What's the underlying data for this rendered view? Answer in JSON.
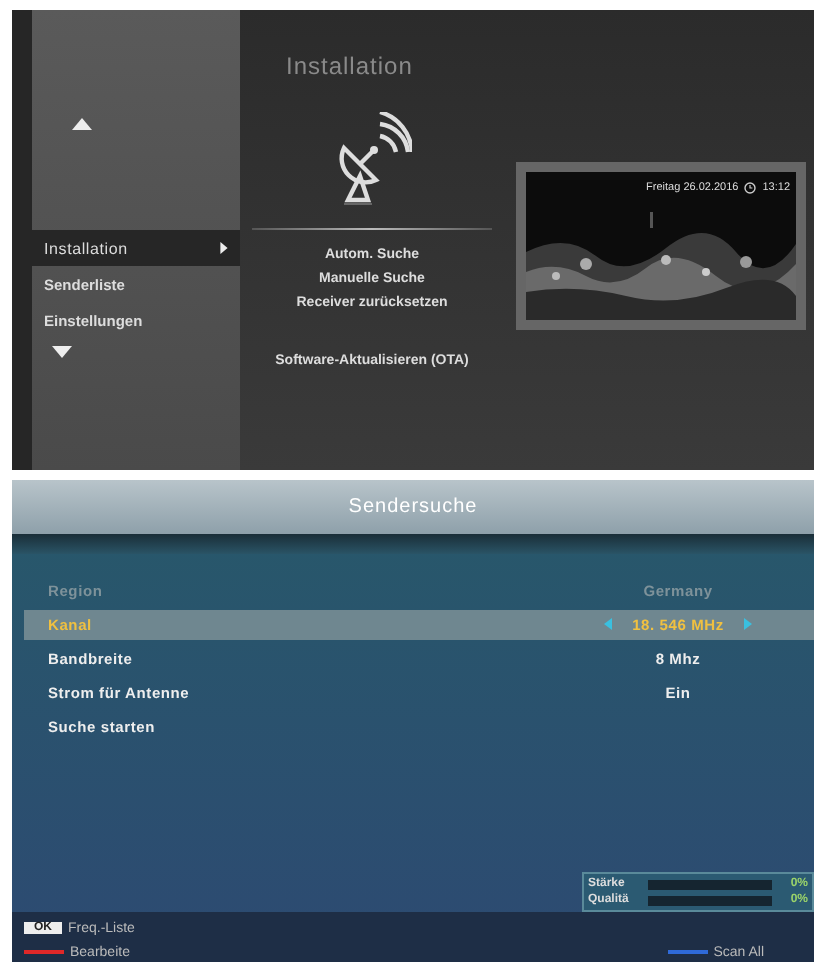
{
  "menu": {
    "title": "Installation",
    "sidebar_items": [
      {
        "label": "Installation",
        "selected": true
      },
      {
        "label": "Senderliste",
        "selected": false
      },
      {
        "label": "Einstellungen",
        "selected": false
      }
    ],
    "submenu": [
      {
        "label": "Autom. Suche",
        "kind": "item"
      },
      {
        "label": "Manuelle Suche",
        "kind": "item"
      },
      {
        "label": "Receiver zurücksetzen",
        "kind": "item"
      },
      {
        "label": "Software-Aktualisieren (OTA)",
        "kind": "spaced"
      }
    ],
    "preview": {
      "date": "Freitag 26.02.2016",
      "time": "13:12"
    }
  },
  "scan": {
    "title": "Sendersuche",
    "rows": [
      {
        "label": "Region",
        "value": "Germany",
        "disabled": true,
        "selected": false
      },
      {
        "label": "Kanal",
        "value": "18. 546 MHz",
        "disabled": false,
        "selected": true
      },
      {
        "label": "Bandbreite",
        "value": "8 Mhz",
        "disabled": false,
        "selected": false
      },
      {
        "label": "Strom für Antenne",
        "value": "Ein",
        "disabled": false,
        "selected": false
      },
      {
        "label": "Suche starten",
        "disabled": false,
        "selected": false
      }
    ],
    "meters": [
      {
        "label": "Stärke",
        "level": 0,
        "reading": "0%"
      },
      {
        "label": "Qualitä",
        "level": 0,
        "reading": "0%"
      }
    ],
    "hints": [
      {
        "kind": "key",
        "key": "OK",
        "label": "Freq.-Liste"
      },
      {
        "kind": "color",
        "color": "#e02828",
        "label": "Bearbeite"
      },
      {
        "kind": "color",
        "color": "#2f6ad8",
        "label": "Scan All"
      }
    ]
  }
}
